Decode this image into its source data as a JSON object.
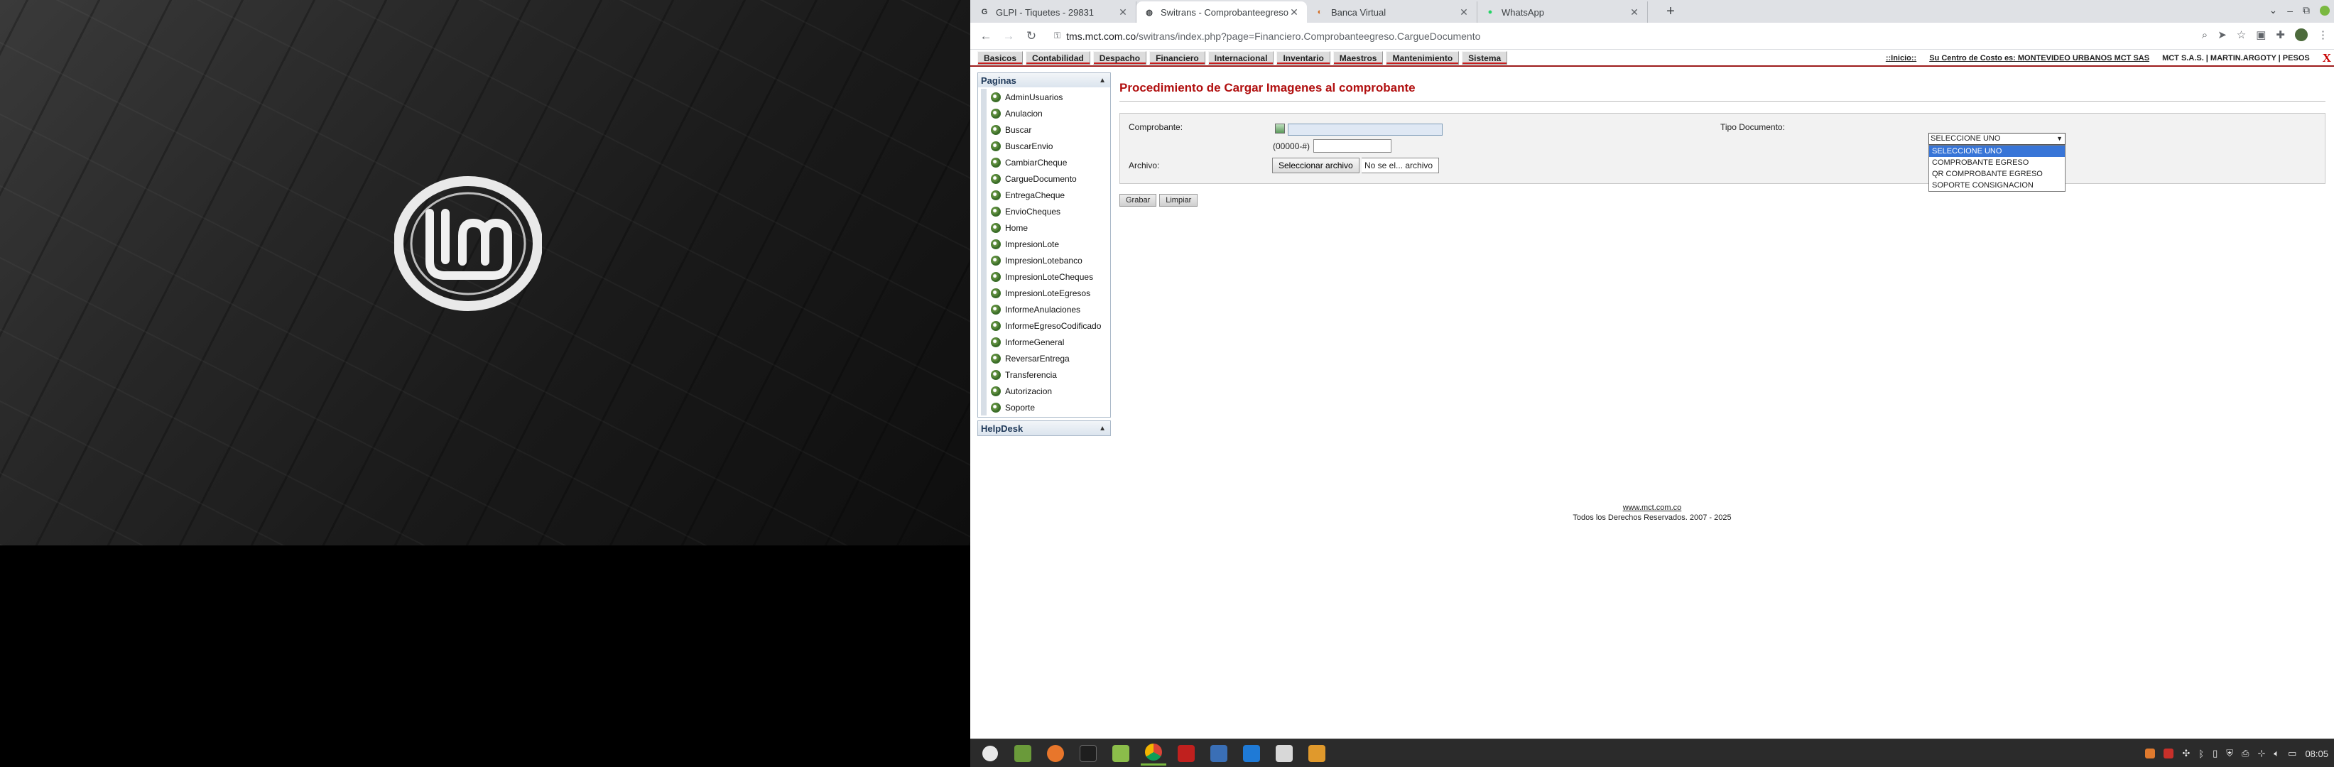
{
  "browser": {
    "tabs": [
      {
        "title": "GLPI - Tiquetes - 29831",
        "favicon": "G",
        "active": false
      },
      {
        "title": "Switrans - Comprobanteegreso",
        "favicon": "globe-icon",
        "active": true
      },
      {
        "title": "Banca Virtual",
        "favicon": "bank-icon",
        "active": false
      },
      {
        "title": "WhatsApp",
        "favicon": "whatsapp-icon",
        "active": false
      }
    ],
    "new_tab": "+",
    "url_host": "tms.mct.com.co",
    "url_path": "/switrans/index.php?page=Financiero.Comprobanteegreso.CargueDocumento"
  },
  "menu": {
    "items": [
      "Basicos",
      "Contabilidad",
      "Despacho",
      "Financiero",
      "Internacional",
      "Inventario",
      "Maestros",
      "Mantenimiento",
      "Sistema"
    ],
    "inicio": "::Inicio::",
    "cost_center": "Su Centro de Costo es: MONTEVIDEO URBANOS MCT SAS",
    "user_info": "MCT S.A.S. | MARTIN.ARGOTY | PESOS",
    "exit": "X"
  },
  "sidebar": {
    "paginas_title": "Paginas",
    "items": [
      "AdminUsuarios",
      "Anulacion",
      "Buscar",
      "BuscarEnvio",
      "CambiarCheque",
      "CargueDocumento",
      "EntregaCheque",
      "EnvioCheques",
      "Home",
      "ImpresionLote",
      "ImpresionLotebanco",
      "ImpresionLoteCheques",
      "ImpresionLoteEgresos",
      "InformeAnulaciones",
      "InformeEgresoCodificado",
      "InformeGeneral",
      "ReversarEntrega",
      "Transferencia",
      "Autorizacion",
      "Soporte"
    ],
    "helpdesk_title": "HelpDesk"
  },
  "main": {
    "title": "Procedimiento de Cargar Imagenes al comprobante",
    "comprobante_label": "Comprobante:",
    "comprobante_hint": "(00000-#)",
    "archivo_label": "Archivo:",
    "file_button": "Seleccionar archivo",
    "file_status": "No se el... archivo",
    "tipo_label": "Tipo Documento:",
    "tipo_selected": "SELECCIONE UNO",
    "tipo_options": [
      "SELECCIONE UNO",
      "COMPROBANTE EGRESO",
      "QR COMPROBANTE EGRESO",
      "SOPORTE CONSIGNACION"
    ],
    "grabar": "Grabar",
    "limpiar": "Limpiar"
  },
  "footer": {
    "link": "www.mct.com.co",
    "rights": "Todos los Derechos Reservados. 2007 - 2025"
  },
  "taskbar": {
    "clock": "08:05"
  }
}
